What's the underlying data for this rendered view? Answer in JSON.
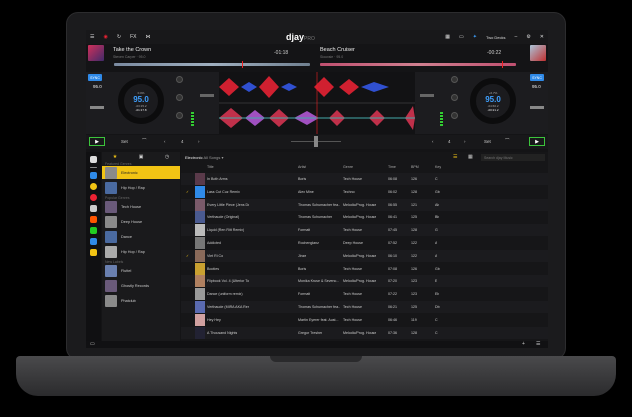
{
  "app": {
    "logo": "djay",
    "logo_suffix": "PRO",
    "fx": "FX",
    "layout_select": "Two Decks"
  },
  "colors": {
    "accent": "#f2c414",
    "sync": "#2f8ae8",
    "play": "#3cc43c",
    "bpm": "#3ea0ff"
  },
  "deck_left": {
    "title": "Take the Crown",
    "artist": "Steven Carper · 95.0",
    "remaining": "-01:18",
    "sync": "SYNC",
    "bpm": "95.0",
    "jog_pitch": "0.0%",
    "jog_bpm": "95.0",
    "jog_elapsed": "-03:15.2",
    "jog_remaining": "-01:17.8",
    "set": "Set",
    "loop": "4",
    "play_icon": "play-icon"
  },
  "deck_right": {
    "title": "Beach Cruiser",
    "artist": "Siouxsie · 95.0",
    "remaining": "-00:22",
    "sync": "SYNC",
    "bpm": "95.0",
    "jog_pitch": "+6.7%",
    "jog_bpm": "95.0",
    "jog_elapsed": "-04:60.2",
    "jog_remaining": "-00:21.2",
    "set": "Set",
    "loop": "4",
    "play_icon": "play-icon"
  },
  "sidebar": {
    "featured_label": "Featured Genres",
    "featured": [
      {
        "label": "Electronic",
        "selected": true
      },
      {
        "label": "Hip Hop / Rap"
      }
    ],
    "popular_label": "Popular Genres",
    "popular": [
      {
        "label": "Tech House"
      },
      {
        "label": "Deep House"
      },
      {
        "label": "Dance"
      },
      {
        "label": "Hip Hop / Rap"
      }
    ],
    "labels_label": "New Labels",
    "labels": [
      {
        "label": "Fluttel"
      },
      {
        "label": "Ghostly Records"
      },
      {
        "label": "Phatclub"
      }
    ]
  },
  "library": {
    "breadcrumb": "Electronic",
    "filter": "All Songs ▾",
    "search_placeholder": "Search djay Music",
    "columns": [
      "Title",
      "Artist",
      "Genre",
      "Time",
      "BPM",
      "Key"
    ],
    "rows": [
      [
        "In Both Arms",
        "Boris",
        "Tech House",
        "06:08",
        "126",
        "C"
      ],
      [
        "Lass Cut Cuz Remix",
        "Alex Mine",
        "Techno",
        "06:02",
        "128",
        "Gb"
      ],
      [
        "Every Little Piece (Jens Deutrich Remix)",
        "Thomas Schumacher fea...",
        "Melodic/Prog. House",
        "06:55",
        "121",
        "Ab"
      ],
      [
        "Verthaude (Original)",
        "Thomas Schumacher",
        "Melodic/Prog. House",
        "06:41",
        "125",
        "Bb"
      ],
      [
        "Liquid (Ren Ritt Remix)",
        "Formatt",
        "Tech House",
        "07:45",
        "128",
        "G"
      ],
      [
        "Addicted",
        "Rochenglanz",
        "Deep House",
        "07:52",
        "122",
        "A"
      ],
      [
        "Viet Ri Co",
        "Jinze",
        "Melodic/Prog. House",
        "06:10",
        "122",
        "A"
      ],
      [
        "Booties",
        "Boris",
        "Tech House",
        "07:08",
        "126",
        "Gb"
      ],
      [
        "Flipbook Vol. 4 (Ulterior Tone Remix)",
        "Monika Kruse & Sevenc...",
        "Melodic/Prog. House",
        "07:20",
        "123",
        "E"
      ],
      [
        "Dance (uniform remix)",
        "Formatt",
        "Tech House",
        "07:22",
        "123",
        "Eb"
      ],
      [
        "Verthaude (MIRA AKA Remix)",
        "Thomas Schumacher fea...",
        "Tech House",
        "06:21",
        "125",
        "Db"
      ],
      [
        "Hey Hey",
        "Martin Eyerer feat. Aust...",
        "Tech House",
        "06:46",
        "119",
        "C"
      ],
      [
        "A Thousand Nights",
        "Gregor Tresher",
        "Melodic/Prog. House",
        "07:36",
        "128",
        "C"
      ]
    ],
    "checked_rows": [
      1,
      6
    ]
  }
}
